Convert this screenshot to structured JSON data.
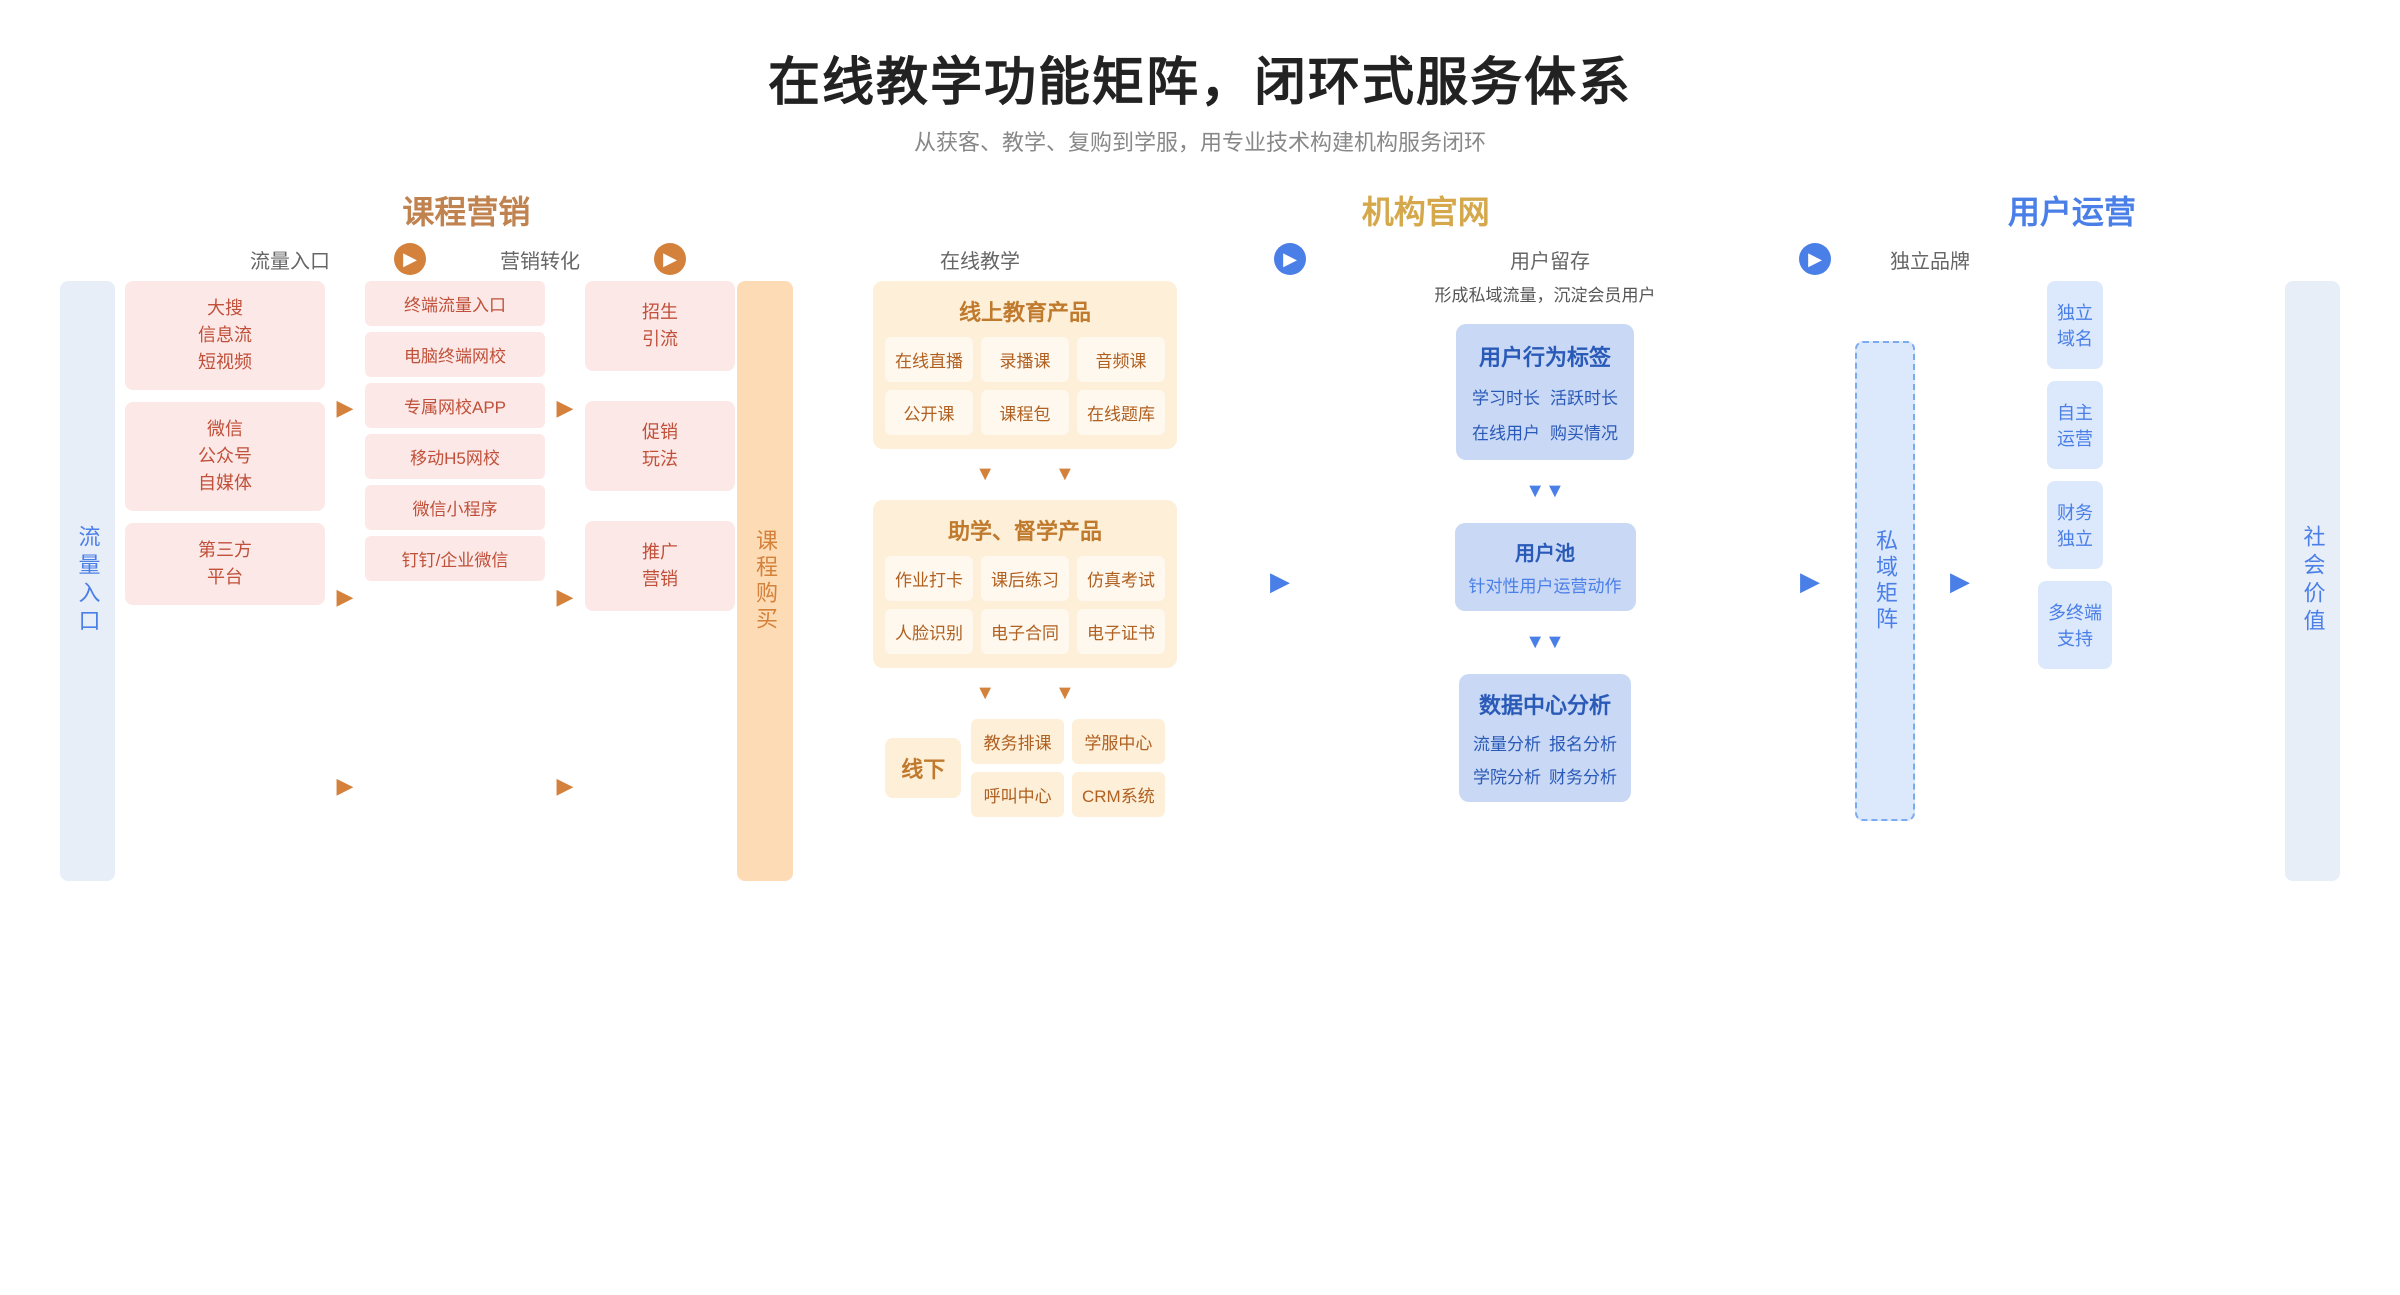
{
  "header": {
    "title": "在线教学功能矩阵，闭环式服务体系",
    "subtitle": "从获客、教学、复购到学服，用专业技术构建机构服务闭环"
  },
  "sections": {
    "kecheng": "课程营销",
    "jigou": "机构官网",
    "yonghu": "用户运营"
  },
  "stages": {
    "traffic_entry": "流量入口",
    "marketing_conv": "营销转化",
    "online_teaching": "在线教学",
    "user_retain": "用户留存",
    "brand": "独立品牌"
  },
  "left_label": "流量入口",
  "right_label": "社会价值",
  "traffic_sources": [
    {
      "text": "大搜\n信息流\n短视频"
    },
    {
      "text": "微信\n公众号\n自媒体"
    },
    {
      "text": "第三方\n平台"
    }
  ],
  "terminal_items": [
    "终端流量入口",
    "电脑终端网校",
    "专属网校APP",
    "移动H5网校",
    "微信小程序",
    "钉钉/企业微信"
  ],
  "conversion_items": [
    {
      "text": "招生\n引流"
    },
    {
      "text": "促销\n玩法"
    },
    {
      "text": "推广\n营销"
    }
  ],
  "purchase_label": "课程购买",
  "online_education": {
    "title": "线上教育产品",
    "items": [
      "在线直播",
      "录播课",
      "音频课",
      "公开课",
      "课程包",
      "在线题库"
    ]
  },
  "learning_products": {
    "title": "助学、督学产品",
    "items": [
      "作业打卡",
      "课后练习",
      "仿真考试",
      "人脸识别",
      "电子合同",
      "电子证书"
    ]
  },
  "offline": {
    "label": "线下",
    "items": [
      "教务排课",
      "学服中心",
      "呼叫中心",
      "CRM系统"
    ]
  },
  "user_behavior": {
    "top_text": "形成私域流量，沉淀会员用户",
    "title": "用户行为标签",
    "items": [
      "学习时长",
      "活跃时长",
      "在线用户",
      "购买情况"
    ]
  },
  "user_pool": {
    "title": "用户池",
    "subtitle": "针对性用户运营动作"
  },
  "data_center": {
    "title": "数据中心分析",
    "items": [
      "流量分析",
      "报名分析",
      "学院分析",
      "财务分析"
    ]
  },
  "siyu_label": "私域矩阵",
  "brand_items": [
    "独立\n域名",
    "自主\n运营",
    "财务\n独立",
    "多终端\n支持"
  ]
}
